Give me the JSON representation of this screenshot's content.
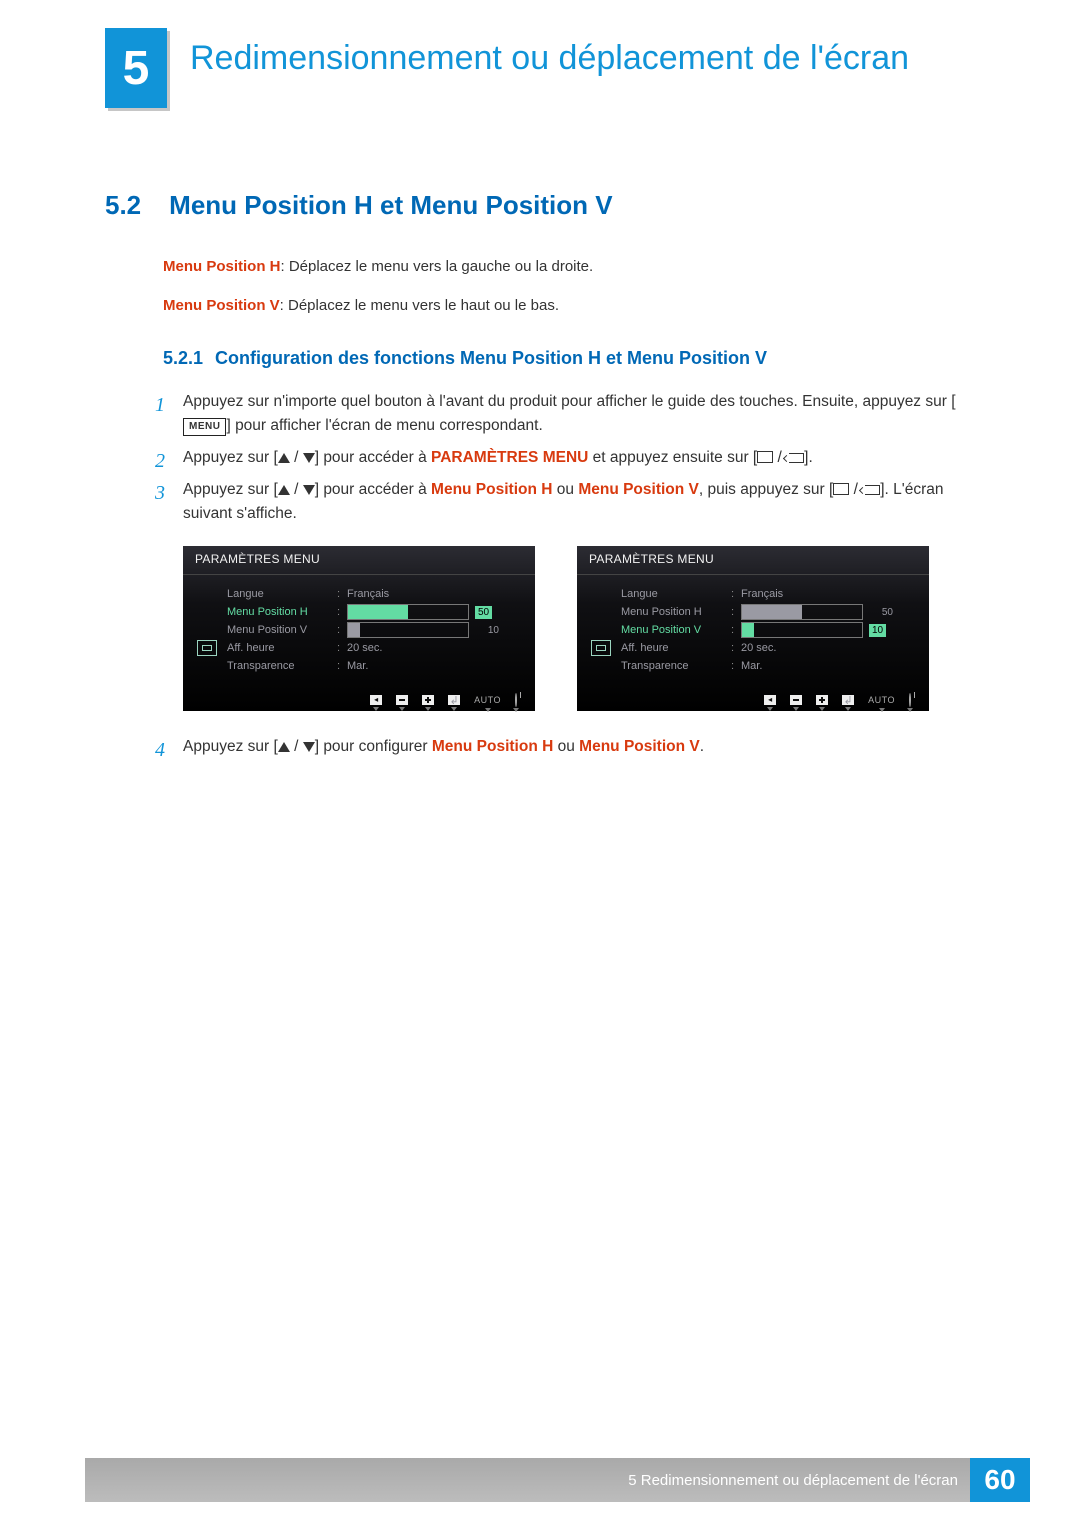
{
  "chapter": {
    "number": "5",
    "title": "Redimensionnement ou déplacement de l'écran"
  },
  "section": {
    "number": "5.2",
    "title": "Menu Position H et Menu Position V"
  },
  "intro": {
    "h_label": "Menu Position H",
    "h_text": ": Déplacez le menu vers la gauche ou la droite.",
    "v_label": "Menu Position V",
    "v_text": ": Déplacez le menu vers le haut ou le bas."
  },
  "subsection": {
    "number": "5.2.1",
    "title": "Configuration des fonctions Menu Position H et Menu Position V"
  },
  "steps": {
    "s1a": "Appuyez sur n'importe quel bouton à l'avant du produit pour afficher le guide des touches. Ensuite, appuyez sur [",
    "s1_menu": "MENU",
    "s1b": "] pour afficher l'écran de menu correspondant.",
    "s2a": "Appuyez sur [",
    "s2b": "] pour accéder à ",
    "s2_target": "PARAMÈTRES MENU",
    "s2c": " et appuyez ensuite sur [",
    "s2d": "].",
    "s3a": "Appuyez sur [",
    "s3b": "] pour accéder à ",
    "s3_h": "Menu Position H",
    "s3_or": " ou ",
    "s3_v": "Menu Position V",
    "s3c": ", puis appuyez sur [",
    "s3d": "]. L'écran suivant s'affiche.",
    "s4a": "Appuyez sur [",
    "s4b": "] pour configurer ",
    "s4_h": "Menu Position H",
    "s4_or": " ou ",
    "s4_v": "Menu Position V",
    "s4c": "."
  },
  "osd": {
    "title": "PARAMÈTRES MENU",
    "items": {
      "langue": "Langue",
      "pos_h": "Menu Position H",
      "pos_v": "Menu Position V",
      "aff": "Aff. heure",
      "trans": "Transparence"
    },
    "values": {
      "langue": "Français",
      "pos_h": "50",
      "pos_v": "10",
      "aff": "20 sec.",
      "trans": "Mar."
    },
    "auto": "AUTO"
  },
  "footer": {
    "text": "5 Redimensionnement ou déplacement de l'écran",
    "page": "60"
  }
}
